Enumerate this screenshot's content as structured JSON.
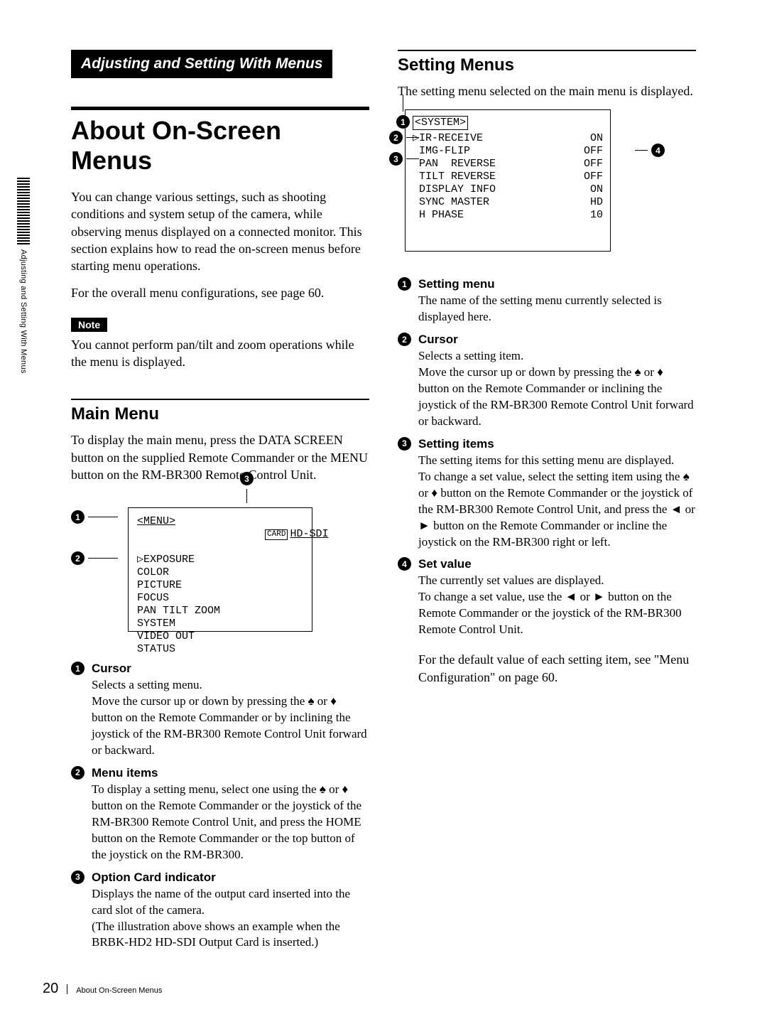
{
  "sidebar_tab": "Adjusting and Setting With Menus",
  "section_label": "Adjusting and Setting With Menus",
  "h1": "About On-Screen Menus",
  "left": {
    "intro": "You can change various settings, such as shooting conditions and system setup of the camera, while observing menus displayed on a connected monitor. This section explains how to read the on-screen menus before starting menu operations.",
    "config_ref": "For the overall menu configurations, see page 60.",
    "note_label": "Note",
    "note_text": "You cannot perform pan/tilt and zoom operations while the menu is displayed.",
    "main_menu_h2": "Main Menu",
    "main_menu_intro": "To display the main menu, press the DATA SCREEN button on the supplied Remote Commander or the MENU button on the RM-BR300 Remote Control Unit.",
    "screen": {
      "title": "<MENU>",
      "card_label": "CARD",
      "card_value": "HD-SDI",
      "items": [
        "EXPOSURE",
        "COLOR",
        "PICTURE",
        "FOCUS",
        "PAN TILT ZOOM",
        "SYSTEM",
        "VIDEO OUT",
        "STATUS"
      ]
    },
    "items": [
      {
        "n": "1",
        "title": "Cursor",
        "body": "Selects a setting menu.\nMove the cursor up or down by pressing the ♠ or ♦ button on the Remote Commander or by inclining the joystick of the RM-BR300 Remote Control Unit forward or backward."
      },
      {
        "n": "2",
        "title": "Menu items",
        "body": "To display a setting menu, select one using the ♠ or ♦ button on the Remote Commander or the joystick of the RM-BR300 Remote Control Unit, and press the HOME button on the Remote Commander or the top button of the joystick on the RM-BR300."
      },
      {
        "n": "3",
        "title": "Option Card indicator",
        "body": "Displays the name of the output card inserted into the card slot of the camera.\n(The illustration above shows an example when the BRBK-HD2 HD-SDI Output Card is inserted.)"
      }
    ]
  },
  "right": {
    "setting_h2": "Setting Menus",
    "setting_intro": "The setting menu selected on the main menu is displayed.",
    "screen": {
      "title": "<SYSTEM>",
      "rows": [
        {
          "label": "IR-RECEIVE",
          "val": "ON"
        },
        {
          "label": "IMG-FLIP",
          "val": "OFF"
        },
        {
          "label": " PAN  REVERSE",
          "val": "OFF"
        },
        {
          "label": " TILT REVERSE",
          "val": "OFF"
        },
        {
          "label": "DISPLAY INFO",
          "val": "ON"
        },
        {
          "label": "SYNC MASTER",
          "val": "HD"
        },
        {
          "label": "H PHASE",
          "val": "10"
        }
      ]
    },
    "items": [
      {
        "n": "1",
        "title": "Setting menu",
        "body": "The name of the setting menu currently selected is displayed here."
      },
      {
        "n": "2",
        "title": "Cursor",
        "body": "Selects a setting item.\nMove the cursor up or down by pressing the ♠ or ♦ button on the Remote Commander or inclining the joystick of the RM-BR300 Remote Control Unit forward or backward."
      },
      {
        "n": "3",
        "title": "Setting items",
        "body": "The setting items for this setting menu are displayed.\nTo change a set value, select the setting item using the ♠ or ♦ button on the Remote Commander or the joystick of the RM-BR300 Remote Control Unit, and press the ◄ or ► button on the Remote Commander or incline the joystick on the RM-BR300 right or left."
      },
      {
        "n": "4",
        "title": "Set value",
        "body": "The currently set values are displayed.\nTo change a set value, use the ◄ or ► button on the Remote Commander or the joystick of the RM-BR300 Remote Control Unit."
      }
    ],
    "default_ref": "For the default value of each setting item, see \"Menu Configuration\" on page 60."
  },
  "footer": {
    "page": "20",
    "title": "About On-Screen Menus"
  }
}
